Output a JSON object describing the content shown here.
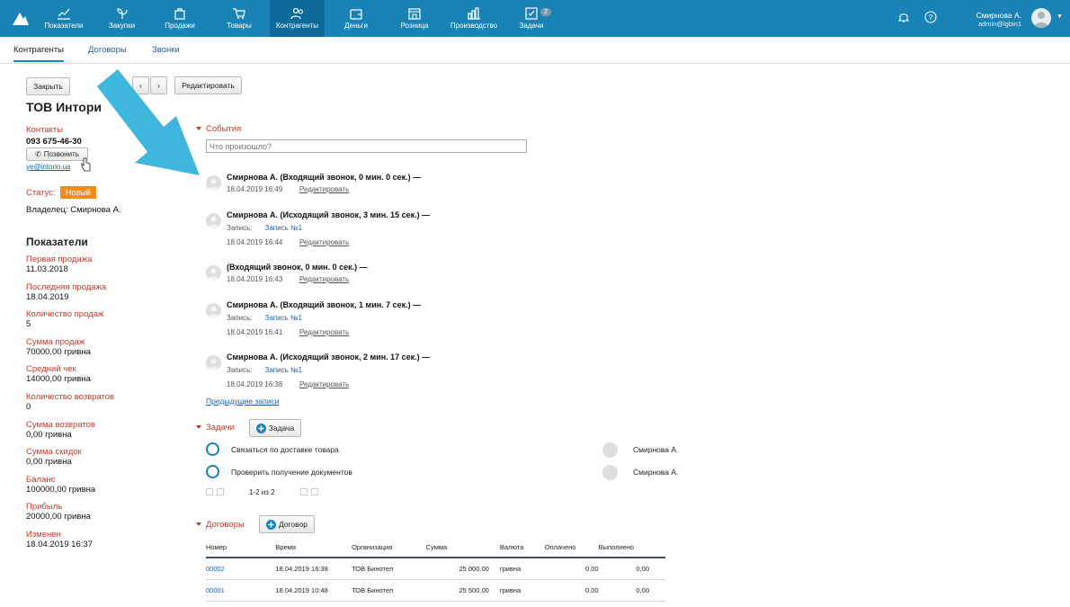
{
  "nav": {
    "items": [
      {
        "label": "Показатели",
        "icon": "chart-line-icon"
      },
      {
        "label": "Закупки",
        "icon": "sprout-icon"
      },
      {
        "label": "Продажи",
        "icon": "bag-icon"
      },
      {
        "label": "Товары",
        "icon": "cart-icon"
      },
      {
        "label": "Контрагенты",
        "icon": "people-icon"
      },
      {
        "label": "Деньги",
        "icon": "wallet-icon"
      },
      {
        "label": "Розница",
        "icon": "store-icon"
      },
      {
        "label": "Производство",
        "icon": "factory-icon"
      },
      {
        "label": "Задачи",
        "icon": "checkbox-icon"
      }
    ],
    "tasks_badge": "2",
    "user_name": "Смирнова А.",
    "user_email": "admin@lgbin1"
  },
  "subtabs": [
    "Контрагенты",
    "Договоры",
    "Звонки"
  ],
  "toolbar": {
    "close": "Закрыть",
    "edit": "Редактировать"
  },
  "company": {
    "name": "ТОВ Интори",
    "contacts_label": "Контакты",
    "phone": "093 675-46-30",
    "call_button": "Позвонить",
    "email": "ye@intorio.ua",
    "status_label": "Статус:",
    "status_value": "Новый",
    "owner_label": "Владелец:",
    "owner_value": "Смирнова А."
  },
  "indicators": {
    "title": "Показатели",
    "items": [
      {
        "label": "Первая продажа",
        "value": "11.03.2018"
      },
      {
        "label": "Последняя продажа",
        "value": "18.04.2019"
      },
      {
        "label": "Количество продаж",
        "value": "5"
      },
      {
        "label": "Сумма продаж",
        "value": "70000,00 гривна"
      },
      {
        "label": "Средний чек",
        "value": "14000,00 гривна"
      },
      {
        "label": "Количество возвратов",
        "value": "0"
      },
      {
        "label": "Сумма возвратов",
        "value": "0,00 гривна"
      },
      {
        "label": "Сумма скидок",
        "value": "0,00 гривна"
      },
      {
        "label": "Баланс",
        "value": "100000,00 гривна"
      },
      {
        "label": "Прибыль",
        "value": "20000,00 гривна"
      },
      {
        "label": "Изменен",
        "value": "18.04.2019 16:37"
      }
    ]
  },
  "events": {
    "title": "События",
    "placeholder": "Что произошло?",
    "edit_label": "Редактировать",
    "record_label": "Запись:",
    "items": [
      {
        "title": "Смирнова А. (Входящий звонок, 0 мин. 0 сек.) —",
        "time": "18.04.2019 16:49",
        "record": ""
      },
      {
        "title": "Смирнова А. (Исходящий звонок, 3 мин. 15 сек.) —",
        "time": "18.04.2019 16:44",
        "record": "Запись №1"
      },
      {
        "title": "(Входящий звонок, 0 мин. 0 сек.) —",
        "time": "18.04.2019 16:43",
        "record": ""
      },
      {
        "title": "Смирнова А. (Входящий звонок, 1 мин. 7 сек.) —",
        "time": "18.04.2019 16:41",
        "record": "Запись №1"
      },
      {
        "title": "Смирнова А. (Исходящий звонок, 2 мин. 17 сек.) —",
        "time": "18.04.2019 16:38",
        "record": "Запись №1"
      }
    ],
    "prev_link": "Предыдущие записи"
  },
  "tasks": {
    "title": "Задачи",
    "add_button": "Задача",
    "items": [
      {
        "text": "Связаться по доставке товара",
        "assignee": "Смирнова А."
      },
      {
        "text": "Проверить получение документов",
        "assignee": "Смирнова А."
      }
    ],
    "pager": "1-2 из 2"
  },
  "contracts": {
    "title": "Договоры",
    "add_button": "Договор",
    "columns": [
      "Номер",
      "Время",
      "Организация",
      "Сумма",
      "Валюта",
      "Оплачено",
      "Выполнено"
    ],
    "rows": [
      [
        "00002",
        "18.04.2019 16:38",
        "ТОВ Бинотел",
        "25 000,00",
        "гривна",
        "0,00",
        "0,00"
      ],
      [
        "00001",
        "18.04.2019 10:48",
        "ТОВ Бинотел",
        "25 500,00",
        "гривна",
        "0,00",
        "0,00"
      ]
    ]
  },
  "colors": {
    "topbar": "#1a83b5",
    "accent_red": "#c0392b",
    "status_orange": "#f28c1b",
    "arrow": "#3fb6dc"
  }
}
